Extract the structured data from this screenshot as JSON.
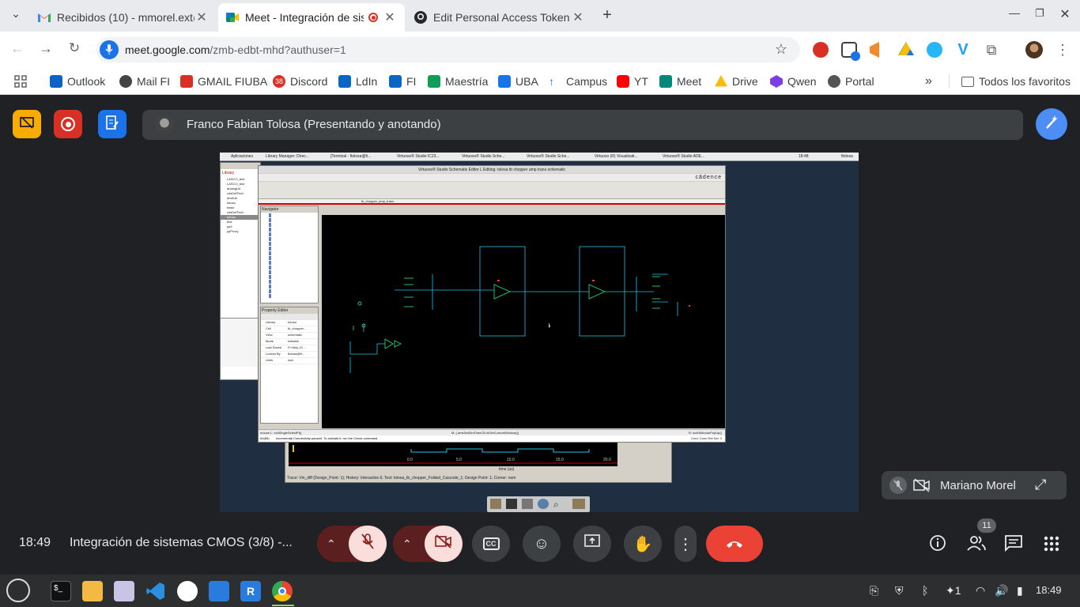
{
  "browser": {
    "tabs": [
      {
        "title": "Recibidos (10) - mmorel.ext@",
        "favicon": "gmail-icon",
        "active": false
      },
      {
        "title": "Meet - Integración de sist",
        "favicon": "meet-icon",
        "active": true
      },
      {
        "title": "Edit Personal Access Token (",
        "favicon": "github-icon",
        "active": false
      }
    ],
    "new_tab": "+",
    "url_domain": "meet.google.com",
    "url_path": "/zmb-edbt-mhd?authuser=1",
    "bookmarks": [
      {
        "label": "Outlook",
        "color": "#0a64c8"
      },
      {
        "label": "Mail FI",
        "color": "#444"
      },
      {
        "label": "GMAIL FIUBA",
        "color": "#d93025"
      },
      {
        "label": "Discord",
        "color": "#d93025",
        "badge": "38"
      },
      {
        "label": "LdIn",
        "color": "#0a66c2"
      },
      {
        "label": "FI",
        "color": "#0a66c2"
      },
      {
        "label": "Maestría",
        "color": "#0f9d58"
      },
      {
        "label": "UBA",
        "color": "#1a73e8"
      },
      {
        "label": "Campus",
        "color": "#1a73e8"
      },
      {
        "label": "YT",
        "color": "#ff0000"
      },
      {
        "label": "Meet",
        "color": "#00897b"
      },
      {
        "label": "Drive",
        "color": "#fbbc04"
      },
      {
        "label": "Qwen",
        "color": "#7b3fe4"
      },
      {
        "label": "Portal",
        "color": "#555"
      }
    ],
    "all_bookmarks": "Todos los favoritos",
    "more_bookmarks": "»"
  },
  "meet": {
    "presenter": "Franco Fabian Tolosa (Presentando y anotando)",
    "self_tile_name": "Mariano Morel",
    "time": "18:49",
    "meeting_title": "Integración de sistemas CMOS (3/8) -...",
    "participants_count": "11"
  },
  "virtuoso": {
    "title": "Virtuoso® Studio Schematic Editor L Editing: tolosa tb chopper amp trans schematic",
    "brand": "cādence",
    "status_bar": "Incremental Connectivity paused. To activate it, run the Check command.",
    "cell_tab": "tb_chopper_amp_trans",
    "navigator_label": "Navigator",
    "property_label": "Property Editor",
    "top_panel_tabs": [
      "Aplicaciones",
      "Library Manager: Direc...",
      "[Terminal - ftolosa@fi...",
      "Virtuoso® Studio IC23...",
      "Virtuoso® Studio Sche...",
      "Virtuoso® Studio Sche...",
      "Virtuoso (R) Visualizati...",
      "Virtuoso® Studio ADE..."
    ],
    "top_time": "18:48",
    "top_user": "ftolosa",
    "property_rows": [
      {
        "k": "Library",
        "v": "tolosa"
      },
      {
        "k": "Cell",
        "v": "tb_chopper..."
      },
      {
        "k": "View",
        "v": "schematic"
      },
      {
        "k": "Mode",
        "v": "editable"
      },
      {
        "k": "Last Saved",
        "v": "Fri May 10 ..."
      },
      {
        "k": "Locked By",
        "v": "ftolosa@fi..."
      },
      {
        "k": "Units",
        "v": "inch"
      }
    ],
    "mouse_hint": "mouse L: schSingleSelectPt()",
    "mouse_mid": "M: (.amsSetDimTimeCB hiGetCurrentWindow())",
    "mouse_right": "R: schHiMousePopUp()",
    "cmd_prompt": "54(89)",
    "cmd_right": "Cmd: Conn Ref Sel: 0",
    "wave_axis": [
      "0.0",
      "5.0",
      "10.0",
      "15.0",
      "20.0"
    ],
    "wave_unit": "time (us)",
    "wave_status": "Trace: Vin_diff (Design_Point: 1); History: Interactive.6; Test: tolosa_tb_chopper_Folded_Cascode_1; Design Point: 1; Corner: nom",
    "library_items": [
      "LASCO_test",
      "LASCO_test",
      "analogLib",
      "cdsDefTech",
      "ahdlLib",
      "tolosa",
      "basic",
      "cdsDefTech",
      "tolosa",
      "test",
      "ypd",
      "ypProxy"
    ]
  },
  "colors": {
    "chrome_bg": "#e8eaed",
    "meet_bg": "#202124",
    "end_call": "#ea4335",
    "muted_pill": "#f9dedc",
    "schematic_wire": "#22c3e6",
    "schematic_dev": "#2ecc71"
  }
}
